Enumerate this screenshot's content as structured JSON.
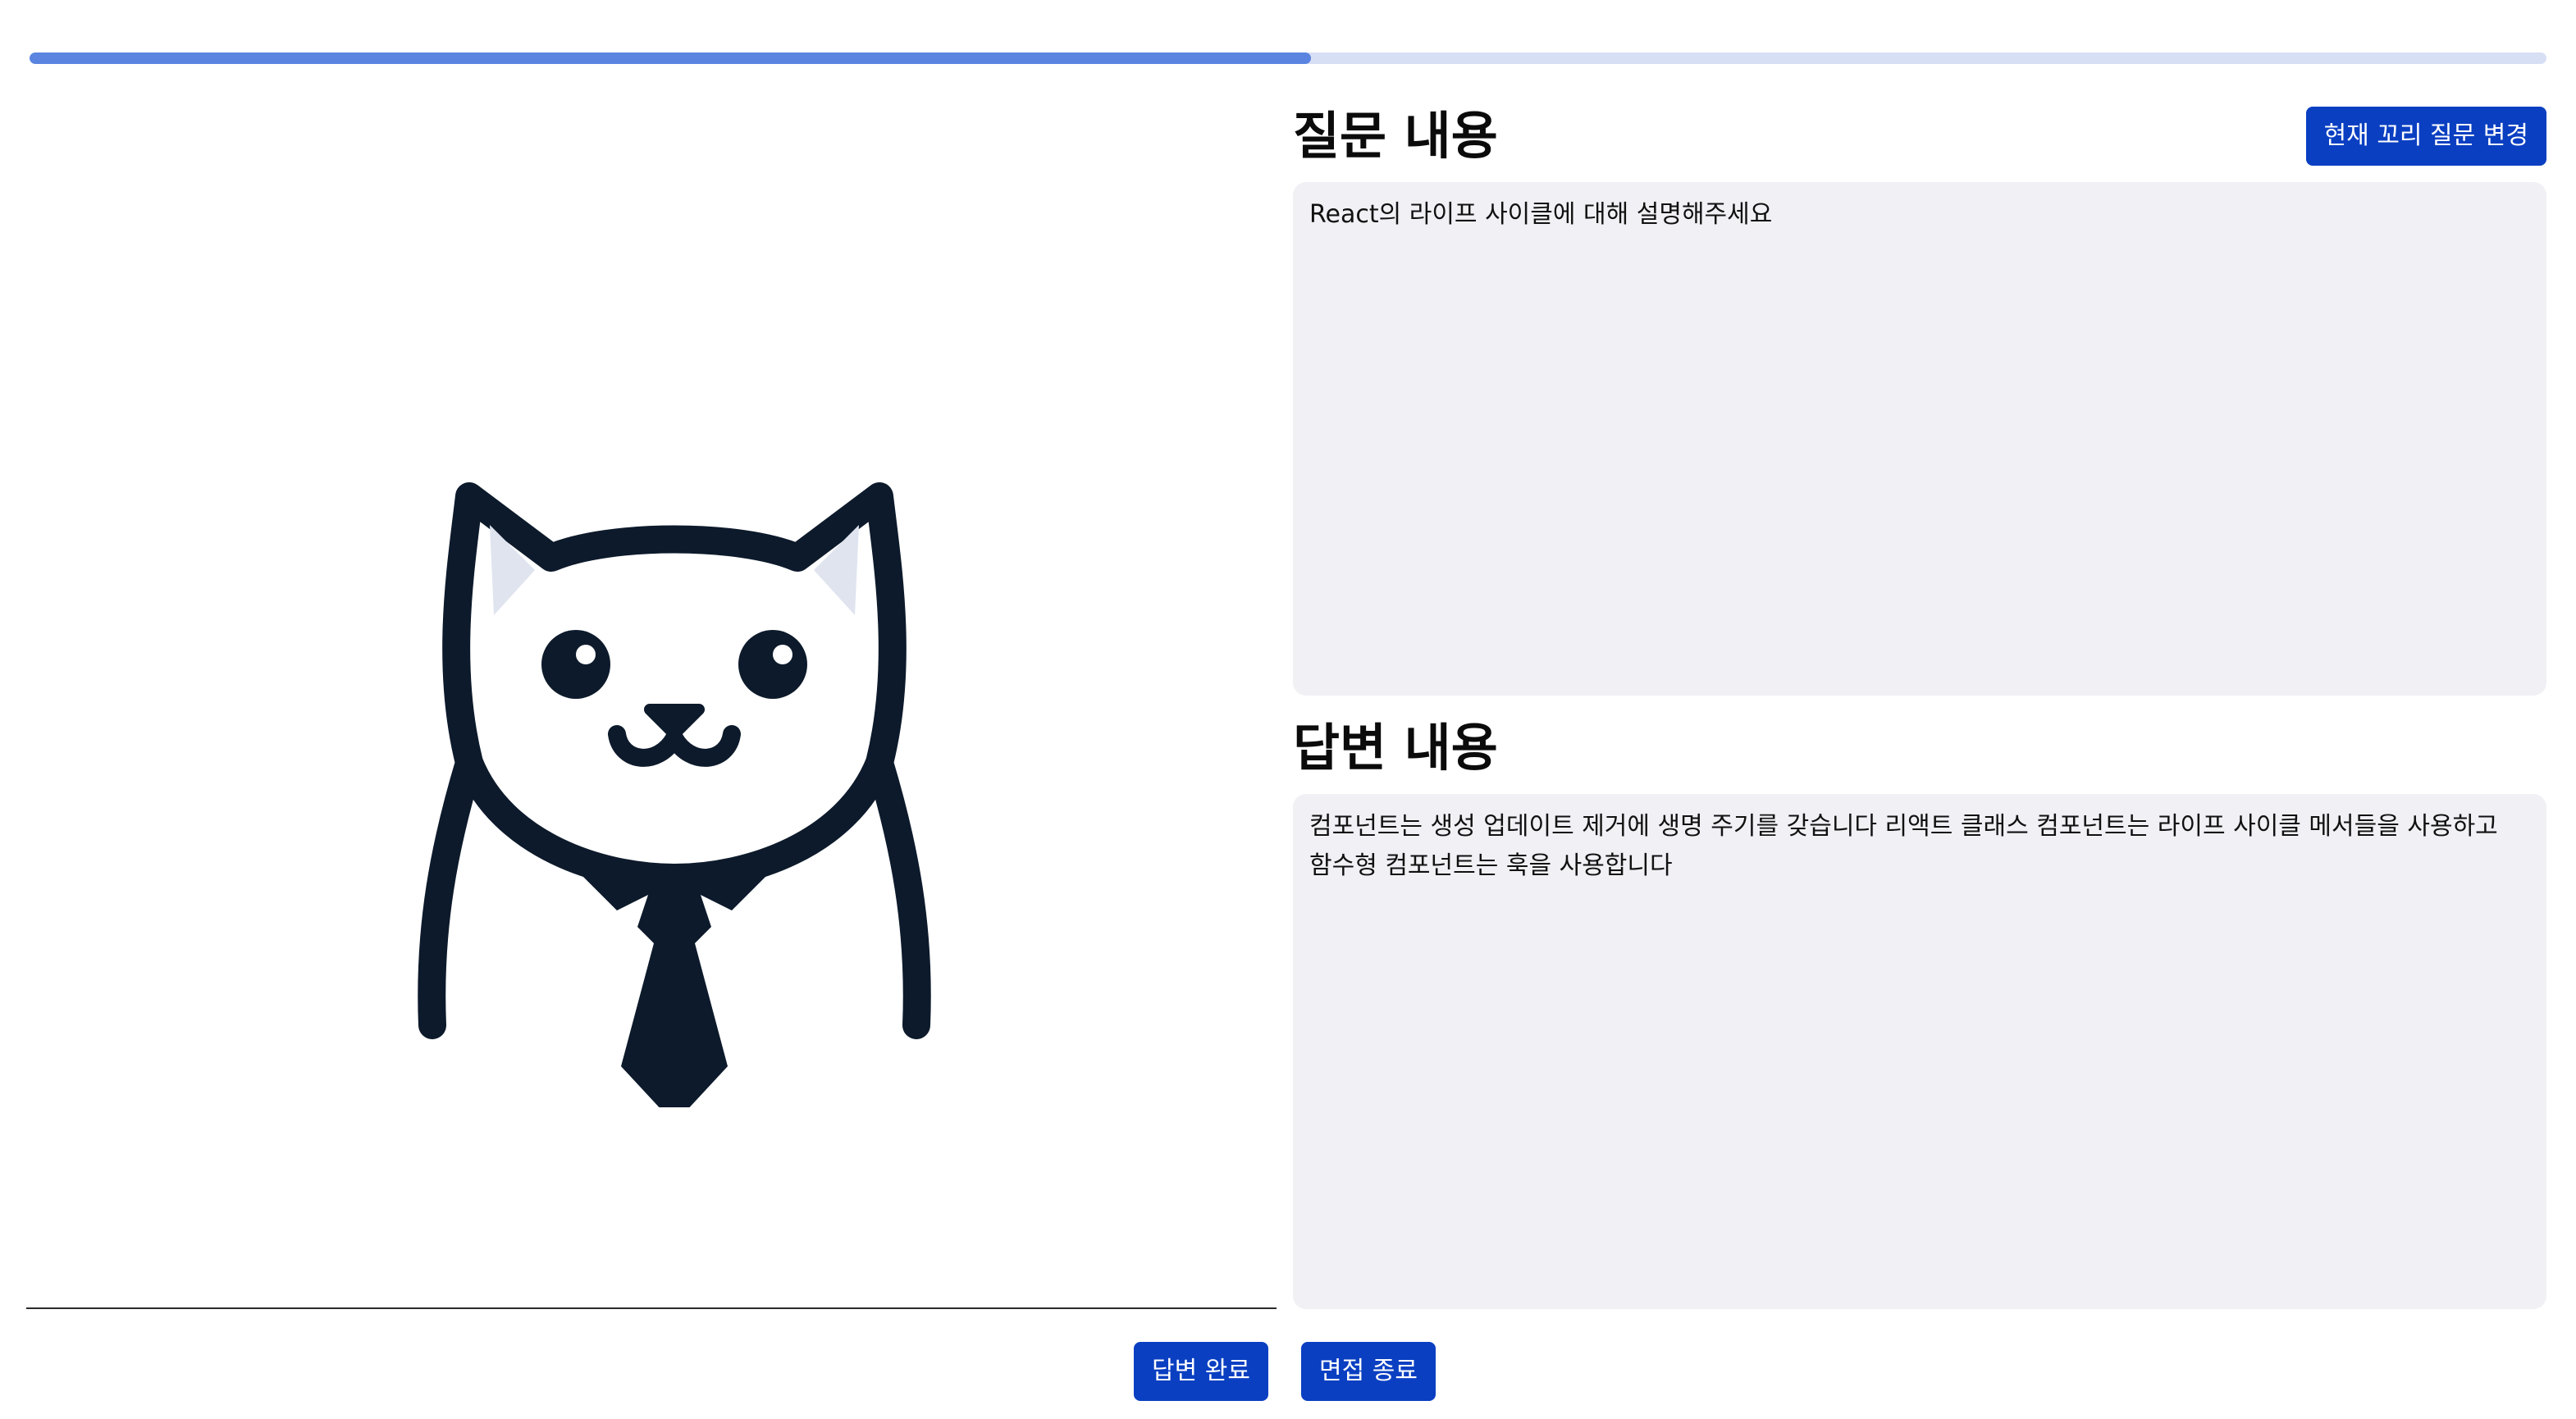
{
  "progress": {
    "fraction": 0.509,
    "track_color": "#d7dff5",
    "fill_color": "#5a84e0"
  },
  "avatar": {
    "icon": "cat-interviewer-icon",
    "description_hidden": true
  },
  "question": {
    "title": "질문 내용",
    "change_button_label": "현재 꼬리 질문 변경",
    "text": "React의 라이프 사이클에 대해 설명해주세요"
  },
  "answer": {
    "title": "답변 내용",
    "text": "컴포넌트는 생성 업데이트 제거에 생명 주기를 갖습니다 리액트 클래스 컴포넌트는 라이프 사이클 메서들을 사용하고 함수형 컴포넌트는 훅을 사용합니다"
  },
  "actions": {
    "complete_label": "답변 완료",
    "end_label": "면접 종료"
  },
  "colors": {
    "primary": "#0a3fc2",
    "box_background": "#f0f0f5"
  }
}
